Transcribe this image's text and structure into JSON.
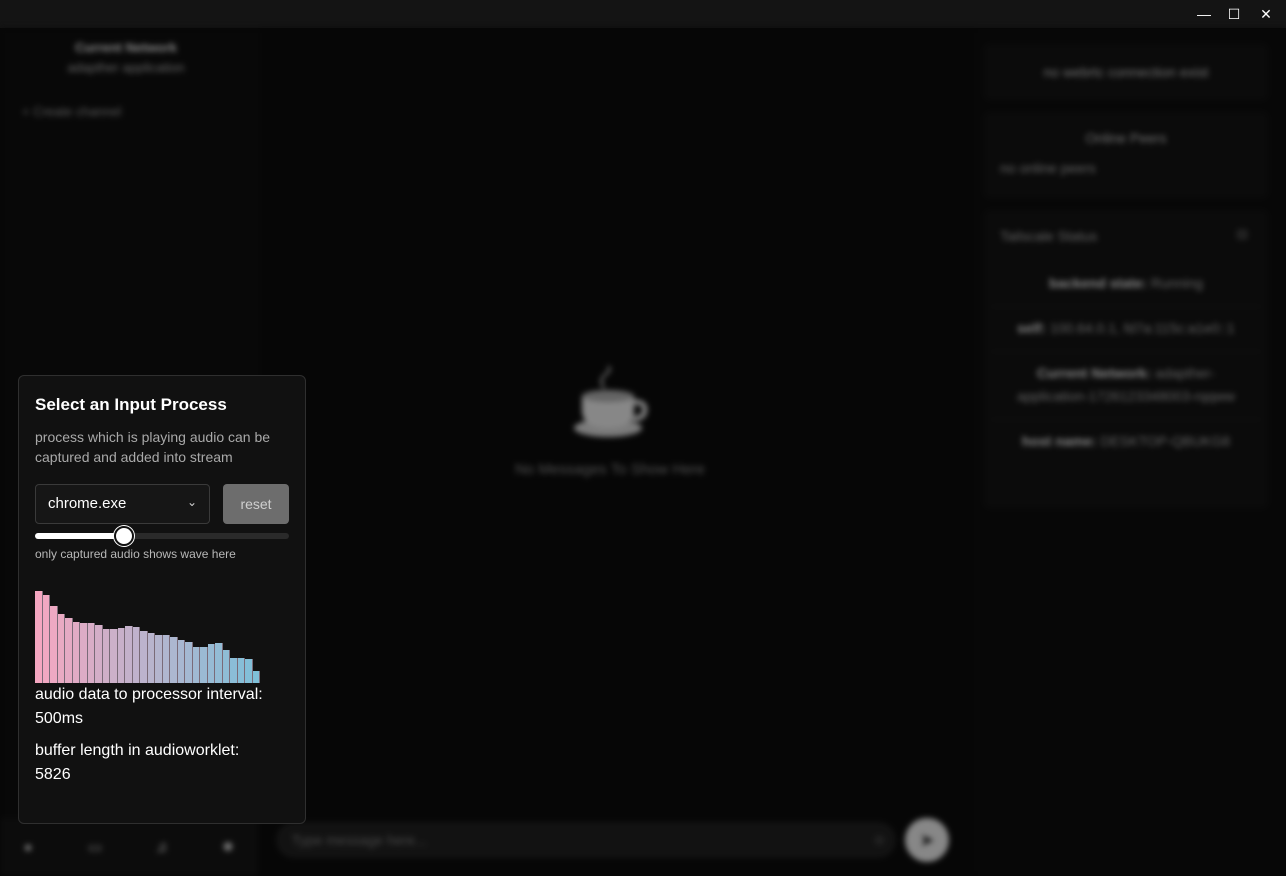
{
  "window_controls": {
    "minimize": "—",
    "maximize": "☐",
    "close": "✕"
  },
  "left_panel": {
    "network_title": "Current Network",
    "network_name": "adapther application",
    "create_channel": "Create channel",
    "bottom_nav_icons": [
      "user-icon",
      "chat-icon",
      "music-icon",
      "settings-icon"
    ]
  },
  "main": {
    "empty_text": "No Messages To Show Here",
    "input_placeholder": "Type message here..."
  },
  "right_panel": {
    "ws_status": "no webrtc connection exist",
    "online_peers_title": "Online Peers",
    "online_peers_empty": "no online peers",
    "status_title": "Tailscale Status",
    "backend_label": "backend state:",
    "backend_value": "Running",
    "self_label": "self:",
    "self_value": "100.64.0.1, fd7a:115c:a1e0::1",
    "network_label": "Current Network:",
    "network_value": "adapther-application-1726123348003-rqqww",
    "host_label": "host name:",
    "host_value": "DESKTOP-QBUKG8"
  },
  "popup": {
    "title": "Select an Input Process",
    "description": "process which is playing audio can be captured and added into stream",
    "selected_process": "chrome.exe",
    "reset_label": "reset",
    "slider_value": 0.35,
    "hint": "only captured audio shows wave here",
    "interval_label": "audio data to processor interval:",
    "interval_value": "500ms",
    "buffer_label": "buffer length in audioworklet:",
    "buffer_value": "5826",
    "wave_levels": [
      0.96,
      0.92,
      0.8,
      0.72,
      0.68,
      0.64,
      0.63,
      0.62,
      0.6,
      0.56,
      0.56,
      0.57,
      0.59,
      0.58,
      0.54,
      0.52,
      0.5,
      0.5,
      0.48,
      0.45,
      0.43,
      0.38,
      0.38,
      0.41,
      0.42,
      0.34,
      0.26,
      0.26,
      0.25,
      0.13
    ],
    "wave_color_start": "#f5a7c1",
    "wave_color_end": "#7fc0d9"
  }
}
